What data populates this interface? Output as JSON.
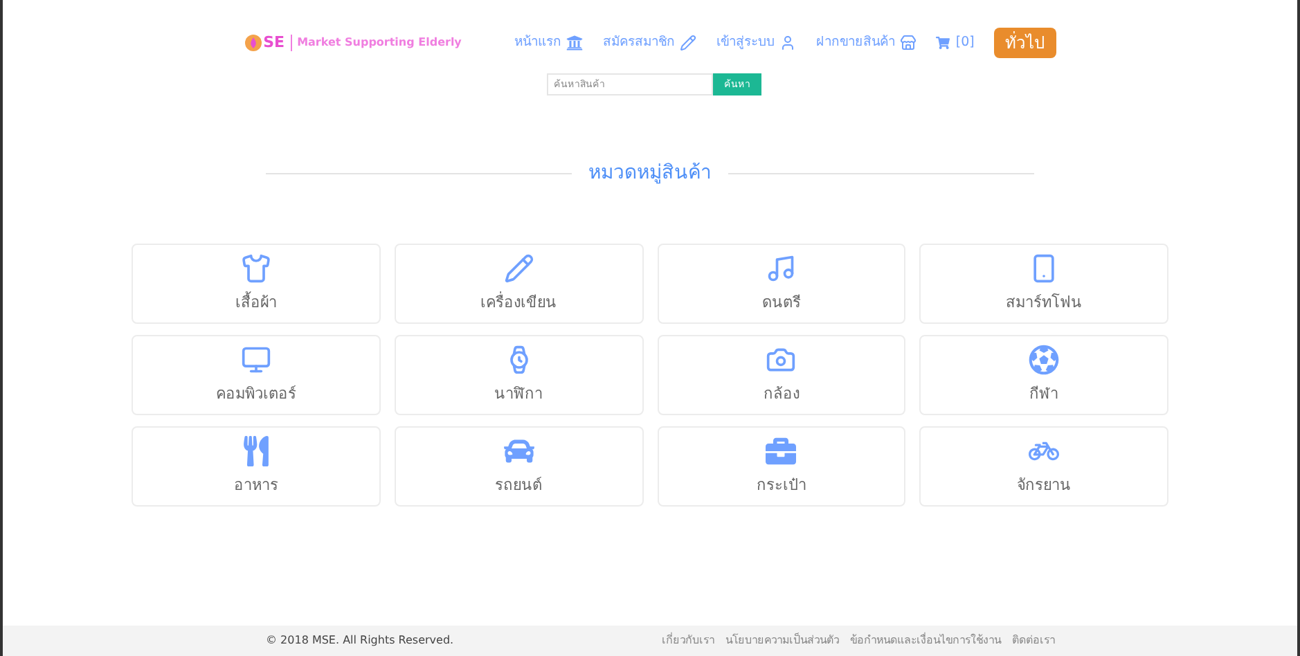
{
  "header": {
    "logo_text": "SE",
    "tagline": "Market Supporting Elderly",
    "nav": [
      {
        "label": "หน้าแรก"
      },
      {
        "label": "สมัครสมาชิก"
      },
      {
        "label": "เข้าสู่ระบบ"
      },
      {
        "label": "ฝากขายสินค้า"
      }
    ],
    "cart": "[0]",
    "mode_button": "ทั่วไป"
  },
  "search": {
    "placeholder": "ค้นหาสินค้า",
    "button": "ค้นหา"
  },
  "section_title": "หมวดหมู่สินค้า",
  "categories": [
    {
      "label": "เสื้อผ้า"
    },
    {
      "label": "เครื่องเขียน"
    },
    {
      "label": "ดนตรี"
    },
    {
      "label": "สมาร์ทโฟน"
    },
    {
      "label": "คอมพิวเตอร์"
    },
    {
      "label": "นาฬิกา"
    },
    {
      "label": "กล้อง"
    },
    {
      "label": "กีฬา"
    },
    {
      "label": "อาหาร"
    },
    {
      "label": "รถยนต์"
    },
    {
      "label": "กระเป๋า"
    },
    {
      "label": "จักรยาน"
    }
  ],
  "footer": {
    "copyright": "© 2018 MSE. All Rights Reserved.",
    "links": [
      "เกี่ยวกับเรา",
      "นโยบายความเป็นส่วนตัว",
      "ข้อกำหนดและเงื่อนไขการใช้งาน",
      "ติดต่อเรา"
    ]
  }
}
